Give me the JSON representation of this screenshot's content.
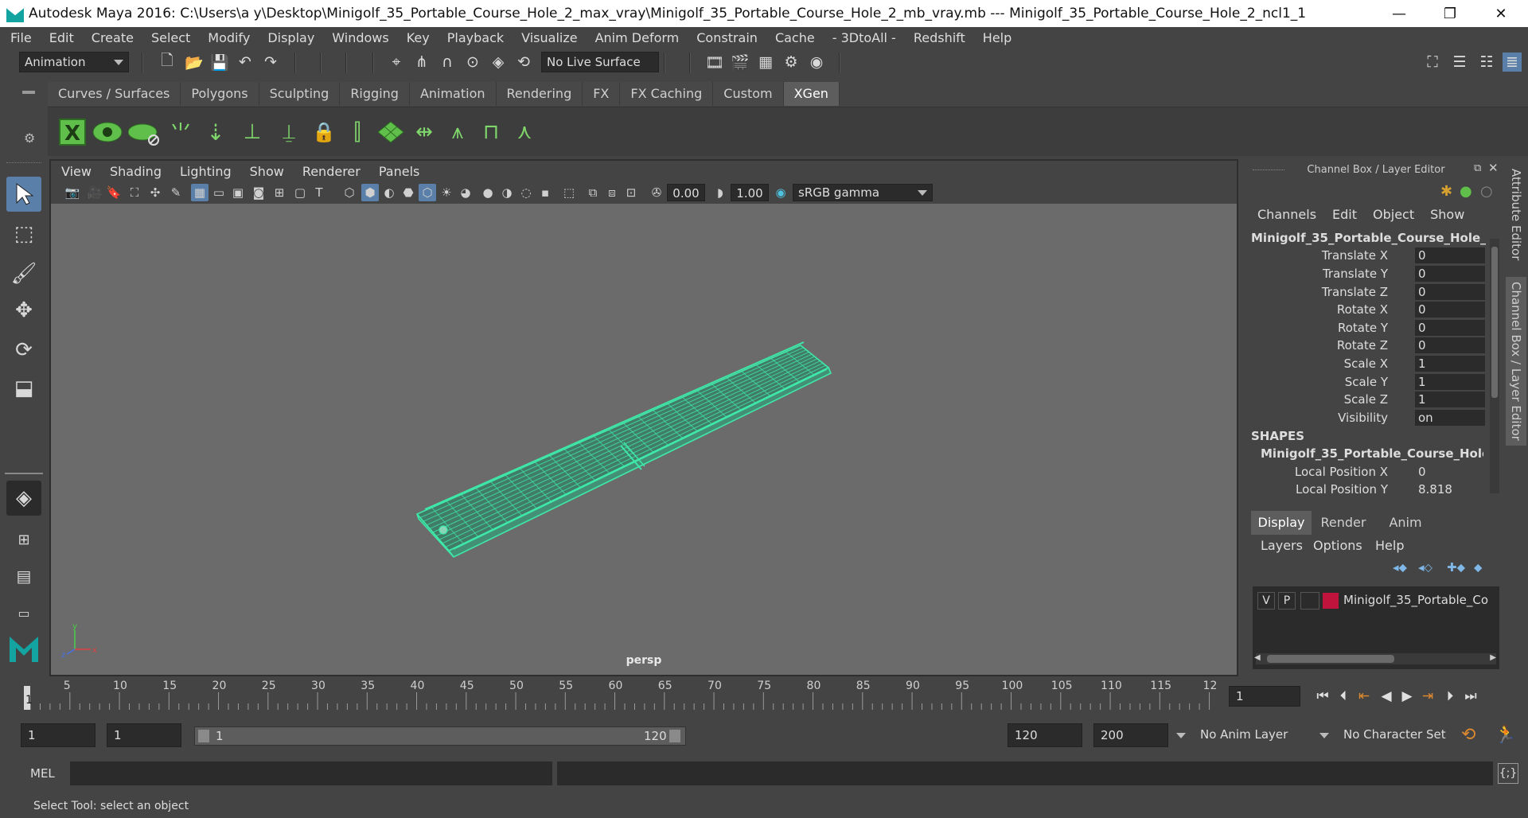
{
  "window": {
    "title": "Autodesk Maya 2016: C:\\Users\\a y\\Desktop\\Minigolf_35_Portable_Course_Hole_2_max_vray\\Minigolf_35_Portable_Course_Hole_2_mb_vray.mb   ---   Minigolf_35_Portable_Course_Hole_2_ncl1_1",
    "minimize": "—",
    "restore": "❐",
    "close": "✕"
  },
  "menus": [
    "File",
    "Edit",
    "Create",
    "Select",
    "Modify",
    "Display",
    "Windows",
    "Key",
    "Playback",
    "Visualize",
    "Anim Deform",
    "Constrain",
    "Cache",
    "- 3DtoAll -",
    "Redshift",
    "Help"
  ],
  "status_line": {
    "mode": "Animation",
    "live_surface": "No Live Surface"
  },
  "shelf_tabs": [
    "Curves / Surfaces",
    "Polygons",
    "Sculpting",
    "Rigging",
    "Animation",
    "Rendering",
    "FX",
    "FX Caching",
    "Custom",
    "XGen"
  ],
  "active_shelf": "XGen",
  "viewport": {
    "menus": [
      "View",
      "Shading",
      "Lighting",
      "Show",
      "Renderer",
      "Panels"
    ],
    "exposure": "0.00",
    "gamma": "1.00",
    "color_space": "sRGB gamma",
    "camera": "persp",
    "axis_y": "y",
    "axis_x": "x",
    "axis_z": "z",
    "model_color": "#3ee8a8"
  },
  "channel_box": {
    "title": "Channel Box / Layer Editor",
    "menus": [
      "Channels",
      "Edit",
      "Object",
      "Show"
    ],
    "object_name": "Minigolf_35_Portable_Course_Hole_2_...",
    "channels": [
      {
        "label": "Translate X",
        "value": "0"
      },
      {
        "label": "Translate Y",
        "value": "0"
      },
      {
        "label": "Translate Z",
        "value": "0"
      },
      {
        "label": "Rotate X",
        "value": "0"
      },
      {
        "label": "Rotate Y",
        "value": "0"
      },
      {
        "label": "Rotate Z",
        "value": "0"
      },
      {
        "label": "Scale X",
        "value": "1"
      },
      {
        "label": "Scale Y",
        "value": "1"
      },
      {
        "label": "Scale Z",
        "value": "1"
      },
      {
        "label": "Visibility",
        "value": "on"
      }
    ],
    "shapes_header": "SHAPES",
    "shape_name": "Minigolf_35_Portable_Course_Hole_...",
    "shape_channels": [
      {
        "label": "Local Position X",
        "value": "0"
      },
      {
        "label": "Local Position Y",
        "value": "8.818"
      }
    ]
  },
  "side_tabs": [
    "Attribute Editor",
    "Channel Box / Layer Editor"
  ],
  "layer_editor": {
    "tabs": [
      "Display",
      "Render",
      "Anim"
    ],
    "active_tab": "Display",
    "menus": [
      "Layers",
      "Options",
      "Help"
    ],
    "layer": {
      "v": "V",
      "p": "P",
      "name": "Minigolf_35_Portable_Co",
      "color": "#c0143c"
    }
  },
  "timeline": {
    "ticks": [
      "5",
      "10",
      "15",
      "20",
      "25",
      "30",
      "35",
      "40",
      "45",
      "50",
      "55",
      "60",
      "65",
      "70",
      "75",
      "80",
      "85",
      "90",
      "95",
      "100",
      "105",
      "110",
      "115",
      "12"
    ],
    "current_frame_marker": "1",
    "current_frame": "1"
  },
  "range": {
    "start": "1",
    "playback_start": "1",
    "slider_start": "1",
    "slider_end": "120",
    "playback_end": "120",
    "end": "200",
    "anim_layer": "No Anim Layer",
    "character_set": "No Character Set"
  },
  "command_line": {
    "language": "MEL"
  },
  "help_line": "Select Tool: select an object"
}
